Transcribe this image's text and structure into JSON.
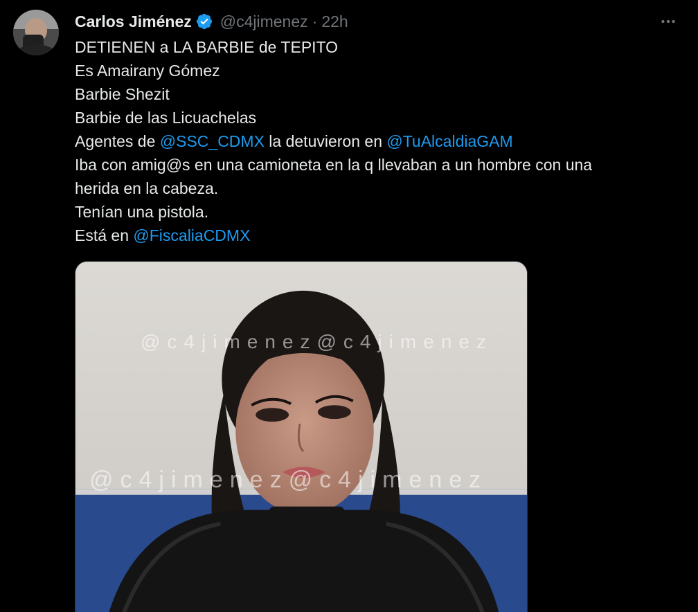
{
  "author": {
    "name": "Carlos Jiménez",
    "handle": "@c4jimenez",
    "separator": "·",
    "time": "22h",
    "verified": true,
    "avatar_icon": "avatar-photo"
  },
  "more_icon": "more-horizontal-icon",
  "colors": {
    "mention": "#1d9bf0",
    "verified": "#1d9bf0",
    "muted": "#71767b",
    "text": "#e7e9ea"
  },
  "tweet": {
    "line1": "DETIENEN a LA BARBIE de TEPITO",
    "line2": "Es Amairany Gómez",
    "line3": "Barbie Shezit",
    "line4": "Barbie de las Licuachelas",
    "line5": {
      "prefix": "Agentes de ",
      "mention1": "@SSC_CDMX",
      "middle": " la detuvieron en ",
      "mention2": "@TuAlcaldiaGAM"
    },
    "line6": "Iba con amig@s en una camioneta en la q llevaban a un hombre con una",
    "line7": "herida en la cabeza.",
    "line8": "Tenían una pistola.",
    "line9": {
      "prefix": "Está en ",
      "mention": "@FiscaliaCDMX"
    }
  },
  "media": {
    "watermark_top": "@c4jimenez@c4jimenez",
    "watermark_bottom": "@c4jimenez@c4jimenez"
  }
}
